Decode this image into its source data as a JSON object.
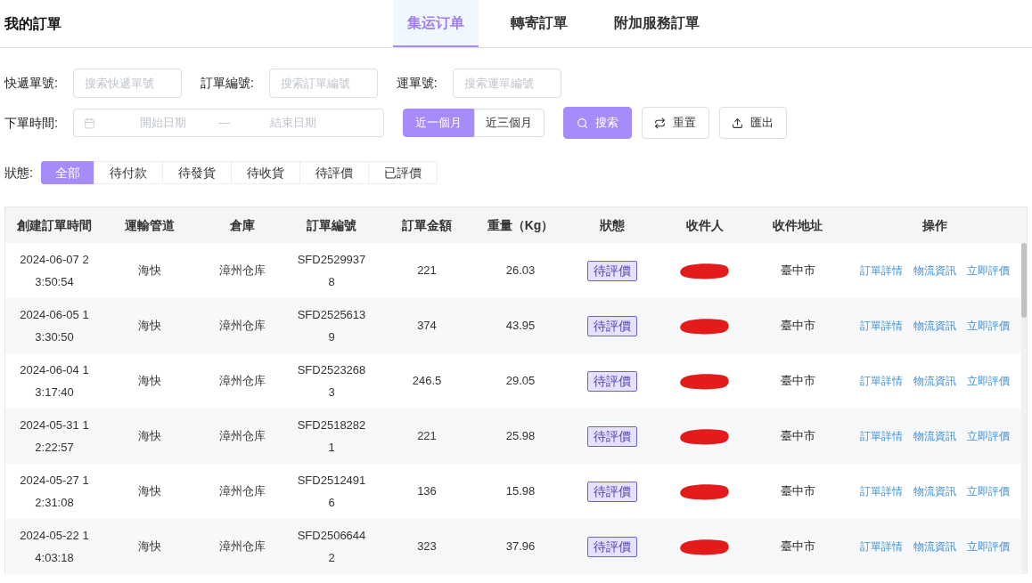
{
  "page": {
    "title": "我的訂單"
  },
  "tabs": [
    {
      "label": "集运订单",
      "selected": true
    },
    {
      "label": "轉寄訂單",
      "selected": false
    },
    {
      "label": "附加服務訂單",
      "selected": false
    }
  ],
  "filters": {
    "fields": [
      {
        "label": "快遞單號:",
        "placeholder": "搜索快遞單號"
      },
      {
        "label": "訂單編號:",
        "placeholder": "搜索訂單編號"
      },
      {
        "label": "運單號:",
        "placeholder": "搜索運單編號"
      }
    ],
    "date_range": {
      "label": "下單時間:",
      "start_placeholder": "開始日期",
      "separator": "—",
      "end_placeholder": "結束日期"
    },
    "quick_ranges": [
      {
        "label": "近一個月",
        "selected": true
      },
      {
        "label": "近三個月",
        "selected": false
      }
    ],
    "buttons": [
      {
        "label": "搜索",
        "kind": "search"
      },
      {
        "label": "重置",
        "kind": "reset"
      },
      {
        "label": "匯出",
        "kind": "export"
      }
    ]
  },
  "status_filter": {
    "label": "狀態:",
    "options": [
      {
        "label": "全部",
        "selected": true
      },
      {
        "label": "待付款",
        "selected": false
      },
      {
        "label": "待發貨",
        "selected": false
      },
      {
        "label": "待收貨",
        "selected": false
      },
      {
        "label": "待評價",
        "selected": false
      },
      {
        "label": "已評價",
        "selected": false
      }
    ]
  },
  "table": {
    "columns": [
      "創建訂單時間",
      "運輸管道",
      "倉庫",
      "訂單編號",
      "訂單金額",
      "重量（Kg）",
      "狀態",
      "收件人",
      "收件地址",
      "操作"
    ],
    "rows": [
      {
        "created": "2024-06-07 23:50:54",
        "channel": "海快",
        "warehouse": "漳州仓库",
        "order_no": "SFD25299378",
        "amount": "221",
        "weight": "26.03",
        "status": "待評價",
        "recipient_redacted": true,
        "address": "臺中市",
        "actions": [
          "訂單詳情",
          "物流資訊",
          "立即評價"
        ]
      },
      {
        "created": "2024-06-05 13:30:50",
        "channel": "海快",
        "warehouse": "漳州仓库",
        "order_no": "SFD25256139",
        "amount": "374",
        "weight": "43.95",
        "status": "待評價",
        "recipient_redacted": true,
        "address": "臺中市",
        "actions": [
          "訂單詳情",
          "物流資訊",
          "立即評價"
        ]
      },
      {
        "created": "2024-06-04 13:17:40",
        "channel": "海快",
        "warehouse": "漳州仓库",
        "order_no": "SFD25232683",
        "amount": "246.5",
        "weight": "29.05",
        "status": "待評價",
        "recipient_redacted": true,
        "address": "臺中市",
        "actions": [
          "訂單詳情",
          "物流資訊",
          "立即評價"
        ]
      },
      {
        "created": "2024-05-31 12:22:57",
        "channel": "海快",
        "warehouse": "漳州仓库",
        "order_no": "SFD25182821",
        "amount": "221",
        "weight": "25.98",
        "status": "待評價",
        "recipient_redacted": true,
        "address": "臺中市",
        "actions": [
          "訂單詳情",
          "物流資訊",
          "立即評價"
        ]
      },
      {
        "created": "2024-05-27 12:31:08",
        "channel": "海快",
        "warehouse": "漳州仓库",
        "order_no": "SFD25124916",
        "amount": "136",
        "weight": "15.98",
        "status": "待評價",
        "recipient_redacted": true,
        "address": "臺中市",
        "actions": [
          "訂單詳情",
          "物流資訊",
          "立即評價"
        ]
      },
      {
        "created": "2024-05-22 14:03:18",
        "channel": "海快",
        "warehouse": "漳州仓库",
        "order_no": "SFD25066442",
        "amount": "323",
        "weight": "37.96",
        "status": "待評價",
        "recipient_redacted": true,
        "address": "臺中市",
        "actions": [
          "訂單詳情",
          "物流資訊",
          "立即評價"
        ]
      }
    ]
  }
}
